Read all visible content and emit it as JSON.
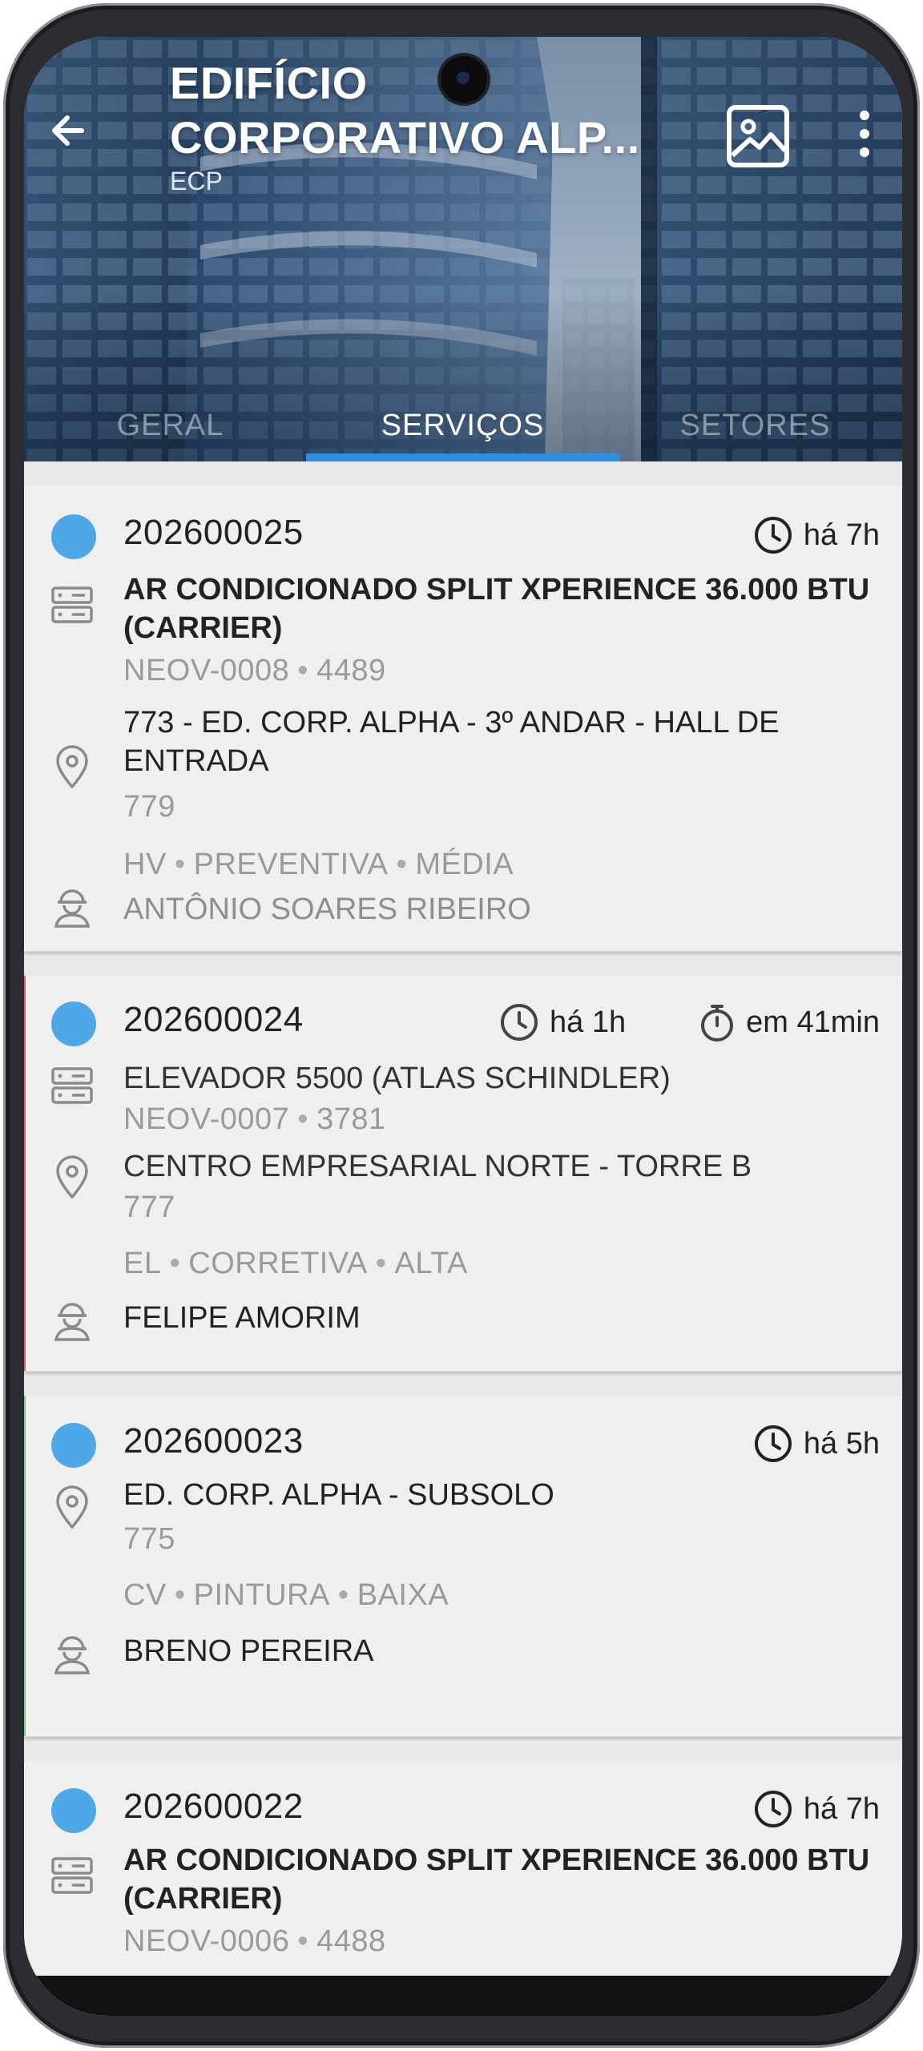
{
  "header": {
    "title_line1": "EDIFÍCIO",
    "title_line2": "CORPORATIVO ALP...",
    "subtitle": "ECP",
    "back_icon": "arrow-left-icon",
    "image_icon": "image-icon",
    "more_icon": "more-vertical-icon"
  },
  "tabs": [
    {
      "label": "GERAL",
      "active": false
    },
    {
      "label": "SERVIÇOS",
      "active": true
    },
    {
      "label": "SETORES",
      "active": false
    }
  ],
  "colors": {
    "accent": "#2f8ee2",
    "status_dot": "#4ea7e6",
    "text": "#222222",
    "muted": "#9a9a9a"
  },
  "services": [
    {
      "number": "202600025",
      "time": "há 7h",
      "equipment": "AR CONDICIONADO SPLIT XPERIENCE 36.000 BTU (CARRIER)",
      "code": "NEOV-0008",
      "code_id": "4489",
      "location": "773 - ED. CORP. ALPHA - 3º ANDAR - HALL DE ENTRADA",
      "location_id": "779",
      "meta": [
        "HV",
        "PREVENTIVA",
        "MÉDIA"
      ],
      "technician": "ANTÔNIO SOARES RIBEIRO"
    },
    {
      "number": "202600024",
      "time": "há 1h",
      "deadline": "em 41min",
      "equipment": "ELEVADOR 5500 (ATLAS SCHINDLER)",
      "code": "NEOV-0007",
      "code_id": "3781",
      "location": "CENTRO EMPRESARIAL NORTE - TORRE B",
      "location_id": "777",
      "meta": [
        "EL",
        "CORRETIVA",
        "ALTA"
      ],
      "technician": "FELIPE AMORIM"
    },
    {
      "number": "202600023",
      "time": "há 5h",
      "location": "ED. CORP. ALPHA - SUBSOLO",
      "location_id": "775",
      "meta": [
        "CV",
        "PINTURA",
        "BAIXA"
      ],
      "technician": "BRENO PEREIRA"
    },
    {
      "number": "202600022",
      "time": "há 7h",
      "equipment": "AR CONDICIONADO SPLIT XPERIENCE 36.000 BTU (CARRIER)",
      "code": "NEOV-0006",
      "code_id": "4488"
    }
  ]
}
